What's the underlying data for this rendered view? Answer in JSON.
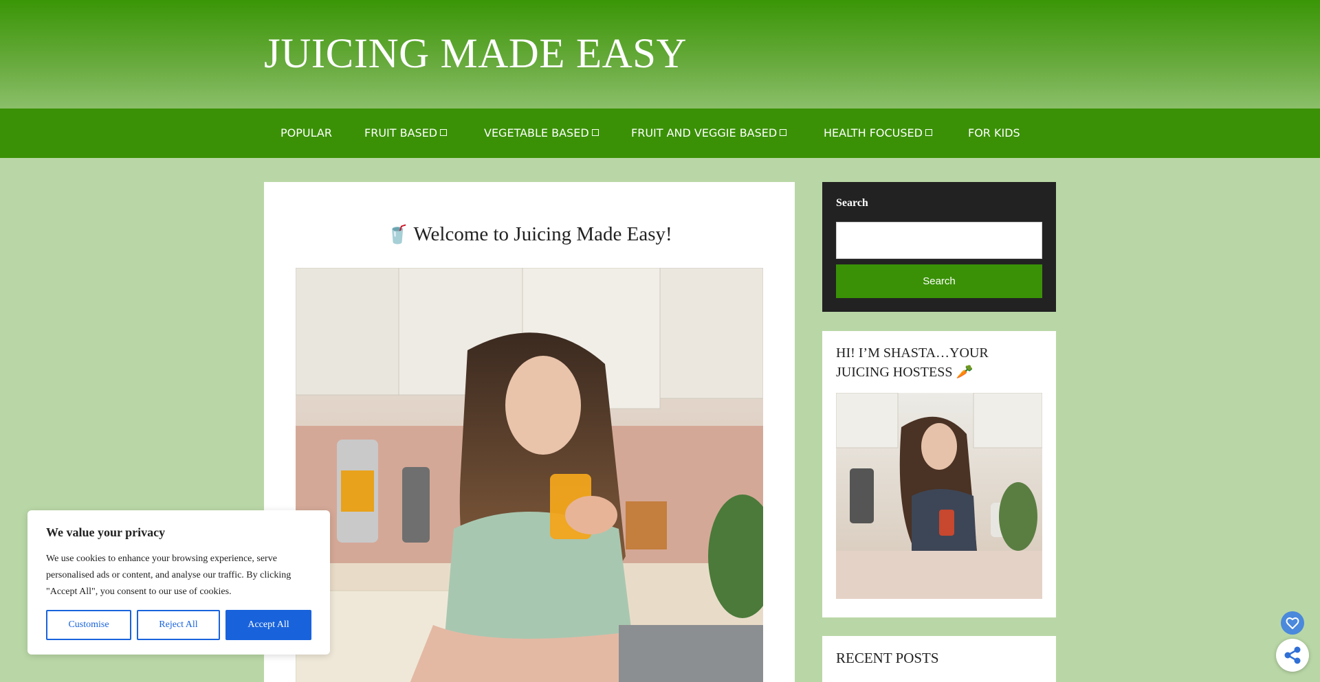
{
  "site": {
    "title": "JUICING MADE EASY"
  },
  "nav": {
    "items": [
      {
        "label": "POPULAR",
        "has_dropdown": false
      },
      {
        "label": "FRUIT BASED",
        "has_dropdown": true
      },
      {
        "label": "VEGETABLE BASED",
        "has_dropdown": true
      },
      {
        "label": "FRUIT AND VEGGIE BASED",
        "has_dropdown": true
      },
      {
        "label": "HEALTH FOCUSED",
        "has_dropdown": true
      },
      {
        "label": "FOR KIDS",
        "has_dropdown": false
      }
    ]
  },
  "post": {
    "emoji": "🥤",
    "title": "Welcome to Juicing Made Easy!"
  },
  "sidebar": {
    "search": {
      "label": "Search",
      "button_label": "Search",
      "input_value": ""
    },
    "about": {
      "title": "HI! I’M SHASTA…YOUR JUICING HOSTESS 🥕"
    },
    "recent": {
      "title": "RECENT POSTS"
    }
  },
  "cookie_banner": {
    "heading": "We value your privacy",
    "body": "We use cookies to enhance your browsing experience, serve personalised ads or content, and analyse our traffic. By clicking \"Accept All\", you consent to our use of cookies.",
    "customise_label": "Customise",
    "reject_label": "Reject All",
    "accept_label": "Accept All"
  },
  "icons": {
    "nav_dropdown": "chevron-box-icon",
    "favorite": "heart-icon",
    "share": "share-icon"
  },
  "colors": {
    "header_green": "#3a9606",
    "nav_green": "#3a9106",
    "page_background": "#b9d7a6",
    "search_widget_bg": "#222222",
    "cookie_accent": "#1863dc"
  }
}
